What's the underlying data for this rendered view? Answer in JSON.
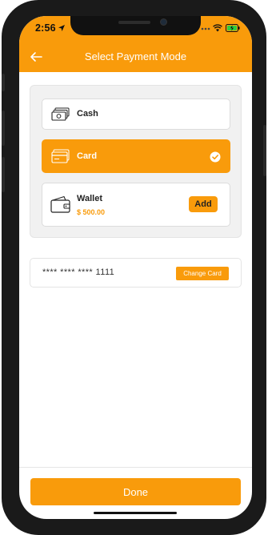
{
  "status_bar": {
    "time": "2:56"
  },
  "header": {
    "title": "Select Payment Mode",
    "back_icon": "arrow-left-icon"
  },
  "payment_options": [
    {
      "label": "Cash",
      "icon": "cash-icon",
      "selected": false
    },
    {
      "label": "Card",
      "icon": "card-icon",
      "selected": true
    },
    {
      "label": "Wallet",
      "icon": "wallet-icon",
      "balance": "$ 500.00",
      "action_label": "Add"
    }
  ],
  "card": {
    "masked_number": "**** **** **** 1111",
    "change_label": "Change Card"
  },
  "footer": {
    "done_label": "Done"
  },
  "colors": {
    "accent": "#f99b0b",
    "panel": "#f1f1f1",
    "text": "#222222"
  }
}
